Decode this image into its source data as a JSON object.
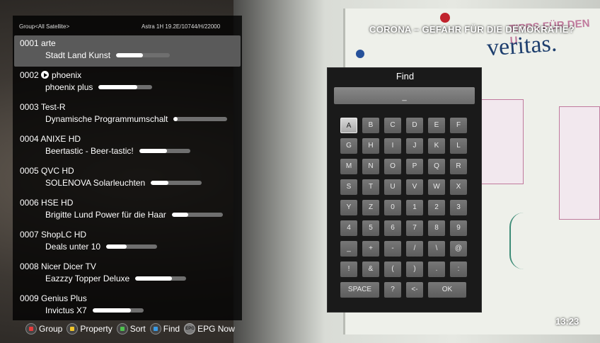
{
  "header": {
    "group": "Group<All Satellite>",
    "satellite": "Astra 1H 19.2E/10744/H/22000"
  },
  "overlay": {
    "headline": "CORONA – GEFAHR FÜR DIE DEMOKRATIE?",
    "poster_title": "veritas.",
    "poster_sub": "TIPPS FÜR DEN U",
    "clock": "13:23"
  },
  "channels": [
    {
      "num": "0001",
      "name": "arte",
      "program": "Stadt Land Kunst",
      "progress": 0.5,
      "selected": true,
      "playing": false
    },
    {
      "num": "0002",
      "name": "phoenix",
      "program": "phoenix plus",
      "progress": 0.72,
      "selected": false,
      "playing": true
    },
    {
      "num": "0003",
      "name": "Test-R",
      "program": "Dynamische Programmumschalt",
      "progress": 0.08,
      "selected": false,
      "playing": false
    },
    {
      "num": "0004",
      "name": "ANIXE HD",
      "program": "Beertastic - Beer-tastic!",
      "progress": 0.55,
      "selected": false,
      "playing": false
    },
    {
      "num": "0005",
      "name": "QVC HD",
      "program": "SOLENOVA Solarleuchten",
      "progress": 0.35,
      "selected": false,
      "playing": false
    },
    {
      "num": "0006",
      "name": "HSE HD",
      "program": "Brigitte Lund Power für die Haar",
      "progress": 0.32,
      "selected": false,
      "playing": false
    },
    {
      "num": "0007",
      "name": "ShopLC HD",
      "program": "Deals unter 10",
      "progress": 0.4,
      "selected": false,
      "playing": false
    },
    {
      "num": "0008",
      "name": "Nicer Dicer TV",
      "program": "Eazzzy Topper Deluxe",
      "progress": 0.72,
      "selected": false,
      "playing": false
    },
    {
      "num": "0009",
      "name": "Genius Plus",
      "program": "Invictus X7",
      "progress": 0.75,
      "selected": false,
      "playing": false
    }
  ],
  "hints": [
    {
      "label": "Group",
      "color": "red"
    },
    {
      "label": "Property",
      "color": "yellow"
    },
    {
      "label": "Sort",
      "color": "green"
    },
    {
      "label": "Find",
      "color": "blue"
    },
    {
      "label": "EPG Now",
      "color": "epg",
      "badge": "EPG"
    }
  ],
  "find": {
    "title": "Find",
    "input": "_",
    "rows": [
      [
        "A",
        "B",
        "C",
        "D",
        "E",
        "F"
      ],
      [
        "G",
        "H",
        "I",
        "J",
        "K",
        "L"
      ],
      [
        "M",
        "N",
        "O",
        "P",
        "Q",
        "R"
      ],
      [
        "S",
        "T",
        "U",
        "V",
        "W",
        "X"
      ],
      [
        "Y",
        "Z",
        "0",
        "1",
        "2",
        "3"
      ],
      [
        "4",
        "5",
        "6",
        "7",
        "8",
        "9"
      ],
      [
        "_",
        "+",
        "-",
        "/",
        "\\",
        "@"
      ],
      [
        "!",
        "&",
        "(",
        ")",
        ".",
        ":"
      ]
    ],
    "bottom": [
      "SPACE",
      "?",
      "<-",
      "OK"
    ]
  }
}
